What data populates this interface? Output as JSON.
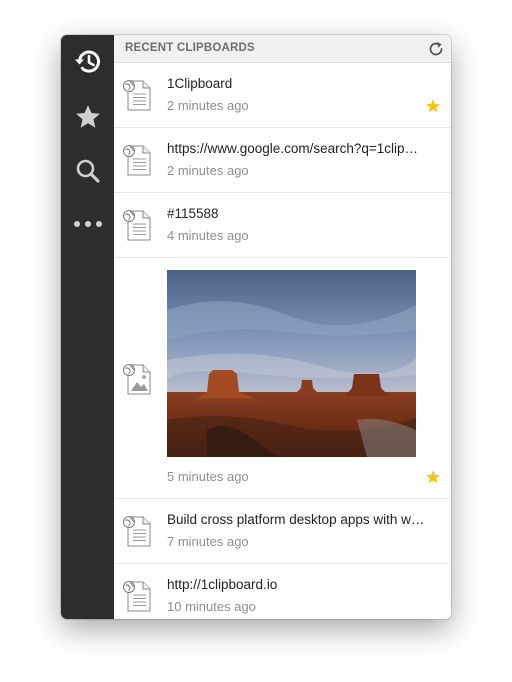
{
  "header": {
    "title": "RECENT CLIPBOARDS"
  },
  "sidebar": {
    "items": [
      {
        "icon": "history-icon",
        "active": true
      },
      {
        "icon": "star-icon",
        "active": false
      },
      {
        "icon": "search-icon",
        "active": false
      },
      {
        "icon": "more-icon",
        "active": false
      }
    ]
  },
  "clips": [
    {
      "title": "1Clipboard",
      "time": "2 minutes ago",
      "starred": true
    },
    {
      "title": "https://www.google.com/search?q=1clip…",
      "time": "2 minutes ago",
      "starred": false
    },
    {
      "title": "#115588",
      "time": "4 minutes ago",
      "starred": false
    },
    {
      "title": "",
      "time": "5 minutes ago",
      "starred": true,
      "kind": "image"
    },
    {
      "title": "Build cross platform desktop apps with w…",
      "time": "7 minutes ago",
      "starred": false
    },
    {
      "title": "http://1clipboard.io",
      "time": "10 minutes ago",
      "starred": false
    }
  ],
  "colors": {
    "sidebar": "#2d2d2d",
    "star": "#f5c518",
    "header": "#f1f1f1"
  }
}
